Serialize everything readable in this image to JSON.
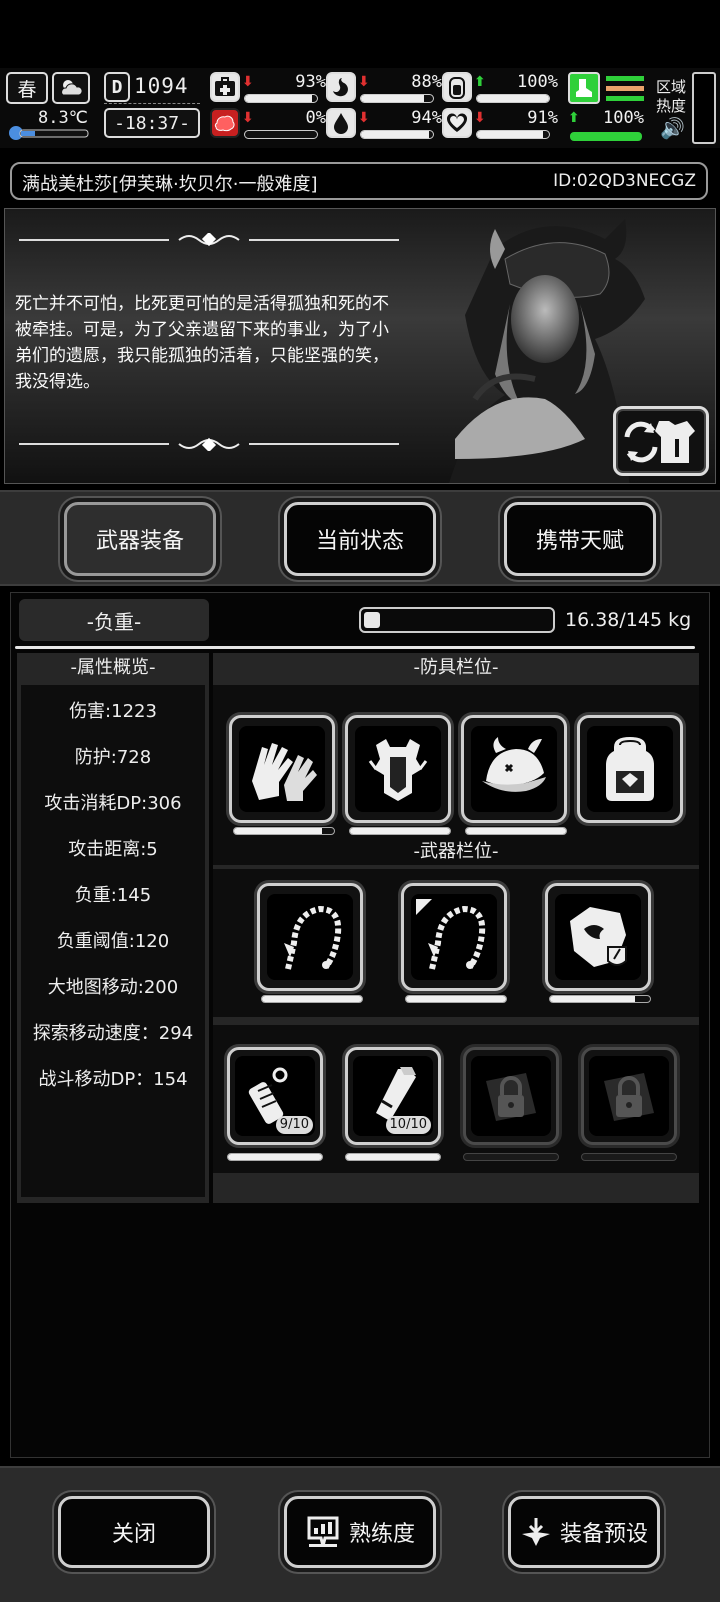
{
  "hud": {
    "season": "春",
    "temperature": "8.3℃",
    "day": "1094",
    "time": "-18:37-",
    "stats": [
      {
        "icon": "medkit-icon",
        "trend": "down",
        "value": "93%",
        "fill": 0.93
      },
      {
        "icon": "stomach-icon",
        "trend": "down",
        "value": "88%",
        "fill": 0.88
      },
      {
        "icon": "battery-icon",
        "trend": "up",
        "value": "100%",
        "fill": 1.0
      },
      {
        "icon": "brain-icon",
        "trend": "down",
        "value": "0%",
        "fill": 0.0
      },
      {
        "icon": "water-drop-icon",
        "trend": "down",
        "value": "94%",
        "fill": 0.94
      },
      {
        "icon": "heart-icon",
        "trend": "down",
        "value": "91%",
        "fill": 0.91
      }
    ],
    "stamina": {
      "trend": "up",
      "value": "100%",
      "fill": 1.0
    },
    "region_heat_label": "区域热度",
    "colors": {
      "down": "#e03030",
      "up": "#2fd03a"
    }
  },
  "title": {
    "name": "满战美杜莎[伊芙琳·坎贝尔·一般难度]",
    "id": "ID:02QD3NECGZ"
  },
  "story": {
    "quote": "死亡并不可怕，比死更可怕的是活得孤独和死的不被牵挂。可是，为了父亲遗留下来的事业，为了小弟们的遗愿，我只能孤独的活着，只能坚强的笑，我没得选。"
  },
  "tabs": [
    {
      "label": "武器装备",
      "active": true
    },
    {
      "label": "当前状态",
      "active": false
    },
    {
      "label": "携带天赋",
      "active": false
    }
  ],
  "weight": {
    "label": "-负重-",
    "text": "16.38/145 kg",
    "fill": 0.113
  },
  "attributes": {
    "header": "-属性概览-",
    "items": [
      "伤害:1223",
      "防护:728",
      "攻击消耗DP:306",
      "攻击距离:5",
      "负重:145",
      "负重阈值:120",
      "大地图移动:200",
      "探索移动速度：294",
      "战斗移动DP：154"
    ]
  },
  "armor": {
    "header": "-防具栏位-",
    "slots": [
      {
        "icon": "gloves-icon",
        "durability": 0.88
      },
      {
        "icon": "body-armor-icon",
        "durability": 1.0
      },
      {
        "icon": "horned-cap-icon",
        "durability": 1.0
      },
      {
        "icon": "backpack-icon",
        "durability": null
      }
    ]
  },
  "weapons": {
    "header": "-武器栏位-",
    "slots": [
      {
        "icon": "thorn-whip-icon",
        "durability": 1.0
      },
      {
        "icon": "thorn-whip-icon",
        "durability": 1.0
      },
      {
        "icon": "shield-icon",
        "durability": 0.85
      }
    ]
  },
  "items": {
    "slots": [
      {
        "icon": "grenade-icon",
        "count": "9/10",
        "locked": false
      },
      {
        "icon": "flashlight-icon",
        "count": "10/10",
        "locked": false
      },
      {
        "icon": "locked-slot-icon",
        "count": "",
        "locked": true
      },
      {
        "icon": "locked-slot-icon",
        "count": "",
        "locked": true
      }
    ]
  },
  "bottom": {
    "close": "关闭",
    "proficiency": "熟练度",
    "preset": "装备预设"
  }
}
